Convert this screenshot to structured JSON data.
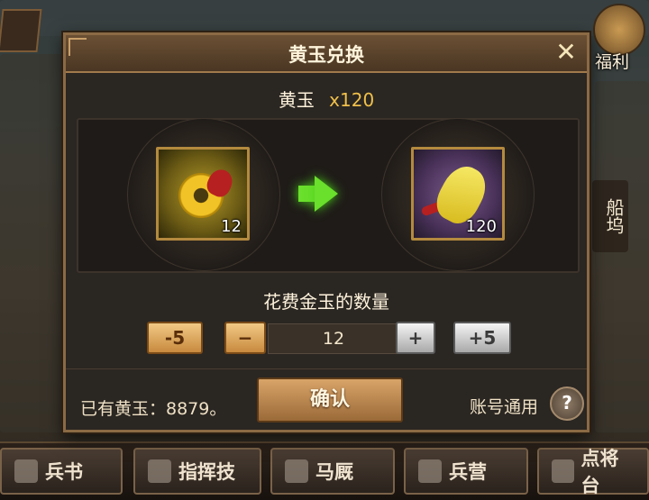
{
  "dialog": {
    "title": "黄玉兑换",
    "close_icon": "close-icon",
    "resource_name": "黄玉",
    "resource_count": "x120",
    "source_item": {
      "icon": "gold-jade-coin-icon",
      "count": "12"
    },
    "target_item": {
      "icon": "yellow-jade-pendant-icon",
      "count": "120"
    },
    "arrow_icon": "green-right-arrow-icon",
    "quantity_label": "花费金玉的数量",
    "minus5_label": "-5",
    "minus_label": "−",
    "quantity_value": "12",
    "plus_label": "+",
    "plus5_label": "+5",
    "owned_text": "已有黄玉：8879。",
    "confirm_label": "确认",
    "shared_text": "账号通用",
    "help_label": "?"
  },
  "side": {
    "fuli_label": "福利",
    "dock_label": "船坞"
  },
  "bottom_nav": [
    {
      "label": "兵书",
      "icon": "book-icon"
    },
    {
      "label": "指挥技",
      "icon": "flag-icon"
    },
    {
      "label": "马厩",
      "icon": "horse-icon"
    },
    {
      "label": "兵营",
      "icon": "shield-icon"
    },
    {
      "label": "点将台",
      "icon": "general-icon"
    }
  ],
  "colors": {
    "accent_gold": "#f0c04a",
    "arrow_green": "#6adf2c"
  }
}
